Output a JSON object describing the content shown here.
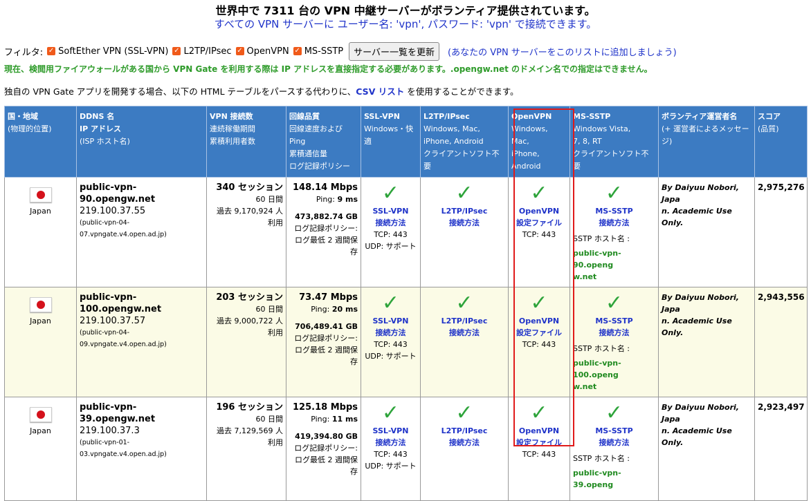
{
  "header": {
    "title": "世界中で 7311 台の VPN 中継サーバーがボランティア提供されています。",
    "subtitle": "すべての VPN サーバーに ユーザー名: 'vpn', パスワード: 'vpn' で接続できます。"
  },
  "filter": {
    "label": "フィルタ:",
    "options": [
      "SoftEther VPN (SSL-VPN)",
      "L2TP/IPsec",
      "OpenVPN",
      "MS-SSTP"
    ],
    "refresh_button": "サーバー一覧を更新",
    "add_link": "(あなたの VPN サーバーをこのリストに追加しましょう)"
  },
  "warning": "現在、検閲用ファイアウォールがある国から VPN Gate を利用する際は IP アドレスを直接指定する必要があります。.opengw.net のドメイン名での指定はできません。",
  "csv_note": {
    "before": "独自の VPN Gate アプリを開発する場合、以下の HTML テーブルをパースする代わりに、",
    "link": "CSV リスト",
    "after": " を使用することができます。"
  },
  "columns": [
    {
      "title": "国・地域",
      "sub": [
        "(物理的位置)"
      ]
    },
    {
      "title": "DDNS 名",
      "sub": [
        "IP アドレス",
        "(ISP ホスト名)"
      ],
      "bold_first_sub": true
    },
    {
      "title": "VPN 接続数",
      "sub": [
        "連続稼働期間",
        "累積利用者数"
      ]
    },
    {
      "title": "回線品質",
      "sub": [
        "回線速度および Ping",
        "累積通信量",
        "ログ記録ポリシー"
      ]
    },
    {
      "title": "SSL-VPN",
      "sub": [
        "Windows・快適"
      ]
    },
    {
      "title": "L2TP/IPsec",
      "sub": [
        "Windows, Mac,",
        "iPhone, Android",
        "クライアントソフト不要"
      ]
    },
    {
      "title": "OpenVPN",
      "sub": [
        "Windows, Mac,",
        "iPhone, Android"
      ]
    },
    {
      "title": "MS-SSTP",
      "sub": [
        "Windows Vista,",
        "7, 8, RT",
        "クライアントソフト不要"
      ]
    },
    {
      "title": "ボランティア運営者名",
      "sub": [
        "(+ 運営者によるメッセージ)"
      ]
    },
    {
      "title": "スコア",
      "sub": [
        "(品質)"
      ]
    }
  ],
  "common": {
    "ssl_link": [
      "SSL-VPN",
      "接続方法"
    ],
    "l2tp_link": [
      "L2TP/IPsec",
      "接続方法"
    ],
    "ovpn_link": [
      "OpenVPN",
      "設定ファイル"
    ],
    "sstp_link": [
      "MS-SSTP",
      "接続方法"
    ],
    "sstp_host_label": "SSTP ホスト名 :",
    "ping_label": "Ping:",
    "log_policy": [
      "ログ記録ポリシー:",
      "ログ最低 2 週間保存"
    ],
    "udp": "UDP: サポート",
    "check": "✓"
  },
  "rows": [
    {
      "country": "Japan",
      "host": "public-vpn-90.opengw.net",
      "ip": "219.100.37.55",
      "isp": "(public-vpn-04-07.vpngate.v4.open.ad.jp)",
      "sessions": "340 セッション",
      "uptime": "60 日間",
      "users": "過去 9,170,924 人利用",
      "speed": "148.14 Mbps",
      "ping": "9 ms",
      "traffic": "473,882.74 GB",
      "ssl_tcp": "TCP: 443",
      "ovpn_tcp": "TCP: 443",
      "sstp_host": [
        "public-vpn-90.openg",
        "w.net"
      ],
      "operator": [
        "By Daiyuu Nobori, Japa",
        "n. Academic Use Only."
      ],
      "score": "2,975,276"
    },
    {
      "country": "Japan",
      "host": "public-vpn-100.opengw.net",
      "ip": "219.100.37.57",
      "isp": "(public-vpn-04-09.vpngate.v4.open.ad.jp)",
      "sessions": "203 セッション",
      "uptime": "60 日間",
      "users": "過去 9,000,722 人利用",
      "speed": "73.47 Mbps",
      "ping": "20 ms",
      "traffic": "706,489.41 GB",
      "ssl_tcp": "TCP: 443",
      "ovpn_tcp": "TCP: 443",
      "sstp_host": [
        "public-vpn-100.openg",
        "w.net"
      ],
      "operator": [
        "By Daiyuu Nobori, Japa",
        "n. Academic Use Only."
      ],
      "score": "2,943,556"
    },
    {
      "country": "Japan",
      "host": "public-vpn-39.opengw.net",
      "ip": "219.100.37.3",
      "isp": "(public-vpn-01-03.vpngate.v4.open.ad.jp)",
      "sessions": "196 セッション",
      "uptime": "60 日間",
      "users": "過去 7,129,569 人利用",
      "speed": "125.18 Mbps",
      "ping": "11 ms",
      "traffic": "419,394.80 GB",
      "ssl_tcp": "TCP: 443",
      "ovpn_tcp": "TCP: 443",
      "sstp_host": [
        "public-vpn-39.openg",
        ""
      ],
      "operator": [
        "By Daiyuu Nobori, Japa",
        "n. Academic Use Only."
      ],
      "score": "2,923,497"
    }
  ]
}
